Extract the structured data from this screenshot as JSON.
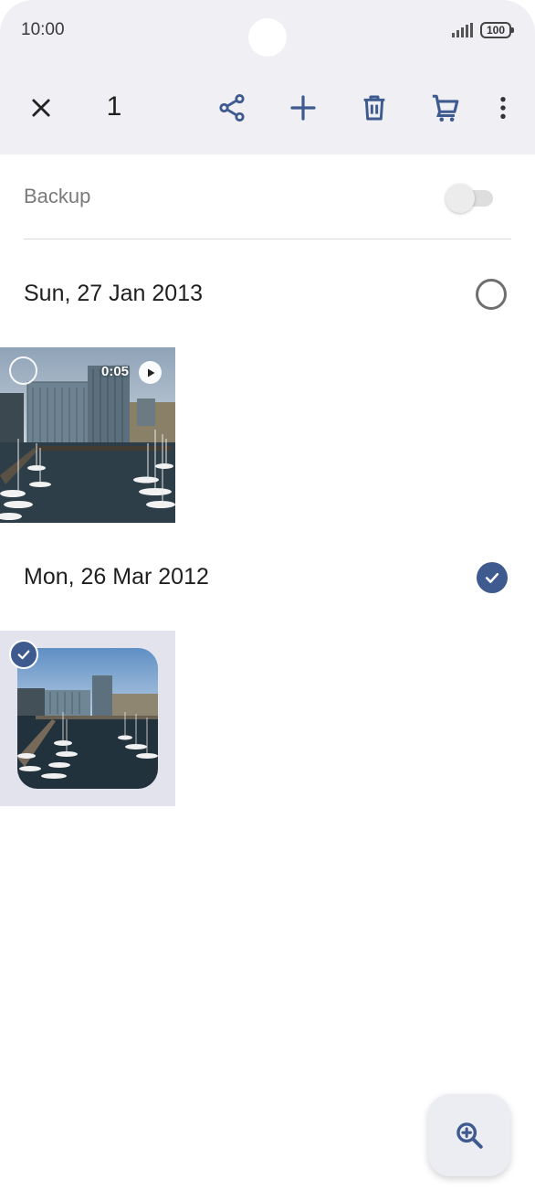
{
  "status_bar": {
    "time": "10:00",
    "battery": "100"
  },
  "toolbar": {
    "selected_count": "1",
    "icons": [
      "close-icon",
      "share-icon",
      "add-icon",
      "delete-icon",
      "cart-icon",
      "more-vert-icon"
    ]
  },
  "backup": {
    "label": "Backup",
    "enabled": false
  },
  "groups": [
    {
      "date": "Sun, 27 Jan 2013",
      "selected": false,
      "items": [
        {
          "type": "video",
          "duration": "0:05",
          "selected": false
        }
      ]
    },
    {
      "date": "Mon, 26 Mar 2012",
      "selected": true,
      "items": [
        {
          "type": "photo",
          "selected": true
        }
      ]
    }
  ],
  "fab": {
    "icon": "zoom-in-icon"
  },
  "colors": {
    "accent": "#3f5a8e",
    "header_bg": "#efeff4",
    "selected_tile_bg": "#e3e3ee"
  }
}
